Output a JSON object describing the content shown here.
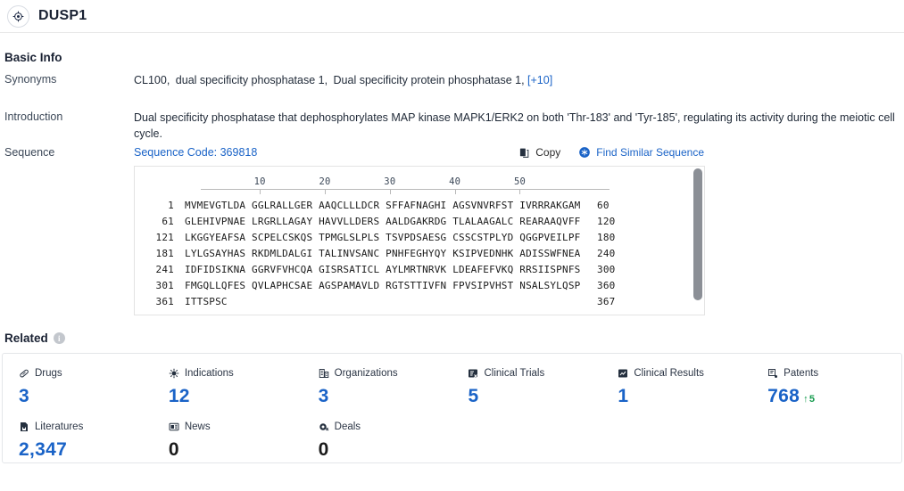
{
  "header": {
    "entity_icon": "target-crosshair-icon",
    "title": "DUSP1"
  },
  "basic_info": {
    "section_title": "Basic Info",
    "rows": {
      "synonyms": {
        "label": "Synonyms",
        "values": [
          "CL100,",
          "dual specificity phosphatase 1,",
          "Dual specificity protein phosphatase 1,"
        ],
        "more_label": "[+10]"
      },
      "introduction": {
        "label": "Introduction",
        "text": "Dual specificity phosphatase that dephosphorylates MAP kinase MAPK1/ERK2 on both 'Thr-183' and 'Tyr-185', regulating its activity during the meiotic cell cycle."
      },
      "sequence": {
        "label": "Sequence",
        "code_label": "Sequence Code: 369818",
        "copy_label": "Copy",
        "copy_icon": "copy-icon",
        "find_similar_label": "Find Similar Sequence",
        "find_similar_icon": "find-similar-sequence-icon"
      }
    }
  },
  "sequence_viewer": {
    "ruler_ticks": [
      10,
      20,
      30,
      40,
      50
    ],
    "lines": [
      {
        "start": "1",
        "chunks": [
          "MVMEVGTLDA",
          "GGLRALLGER",
          "AAQCLLLDCR",
          "SFFAFNAGHI",
          "AGSVNVRFST",
          "IVRRRAKGAM"
        ],
        "end": "60"
      },
      {
        "start": "61",
        "chunks": [
          "GLEHIVPNAE",
          "LRGRLLAGAY",
          "HAVVLLDERS",
          "AALDGAKRDG",
          "TLALAAGALC",
          "REARAAQVFF"
        ],
        "end": "120"
      },
      {
        "start": "121",
        "chunks": [
          "LKGGYEAFSA",
          "SCPELCSKQS",
          "TPMGLSLPLS",
          "TSVPDSAESG",
          "CSSCSTPLYD",
          "QGGPVEILPF"
        ],
        "end": "180"
      },
      {
        "start": "181",
        "chunks": [
          "LYLGSAYHAS",
          "RKDMLDALGI",
          "TALINVSANC",
          "PNHFEGHYQY",
          "KSIPVEDNHK",
          "ADISSWFNEA"
        ],
        "end": "240"
      },
      {
        "start": "241",
        "chunks": [
          "IDFIDSIKNA",
          "GGRVFVHCQA",
          "GISRSATICL",
          "AYLMRTNRVK",
          "LDEAFEFVKQ",
          "RRSIISPNFS"
        ],
        "end": "300"
      },
      {
        "start": "301",
        "chunks": [
          "FMGQLLQFES",
          "QVLAPHCSAE",
          "AGSPAMAVLD",
          "RGTSTTIVFN",
          "FPVSIPVHST",
          "NSALSYLQSP"
        ],
        "end": "360"
      },
      {
        "start": "361",
        "chunks": [
          "ITTSPSC"
        ],
        "end": "367"
      }
    ]
  },
  "related": {
    "title": "Related",
    "info_icon": "info-icon",
    "info_glyph": "i",
    "metrics": [
      {
        "label": "Drugs",
        "icon": "pill-icon",
        "value": "3",
        "style": "blue"
      },
      {
        "label": "Indications",
        "icon": "virus-icon",
        "value": "12",
        "style": "blue"
      },
      {
        "label": "Organizations",
        "icon": "building-icon",
        "value": "3",
        "style": "blue"
      },
      {
        "label": "Clinical Trials",
        "icon": "clinical-trial-icon",
        "value": "5",
        "style": "blue"
      },
      {
        "label": "Clinical Results",
        "icon": "clinical-result-icon",
        "value": "1",
        "style": "blue"
      },
      {
        "label": "Patents",
        "icon": "patent-icon",
        "value": "768",
        "style": "blue",
        "delta": "5",
        "delta_dir": "up"
      },
      {
        "label": "Literatures",
        "icon": "literature-icon",
        "value": "2,347",
        "style": "blue"
      },
      {
        "label": "News",
        "icon": "news-icon",
        "value": "0",
        "style": "zero"
      },
      {
        "label": "Deals",
        "icon": "deal-icon",
        "value": "0",
        "style": "zero"
      }
    ]
  },
  "colors": {
    "link_blue": "#1a63c7",
    "metric_blue": "#1a63c7",
    "delta_green": "#169b4e",
    "text_dark": "#1a2233",
    "border": "#e4e6e9"
  }
}
